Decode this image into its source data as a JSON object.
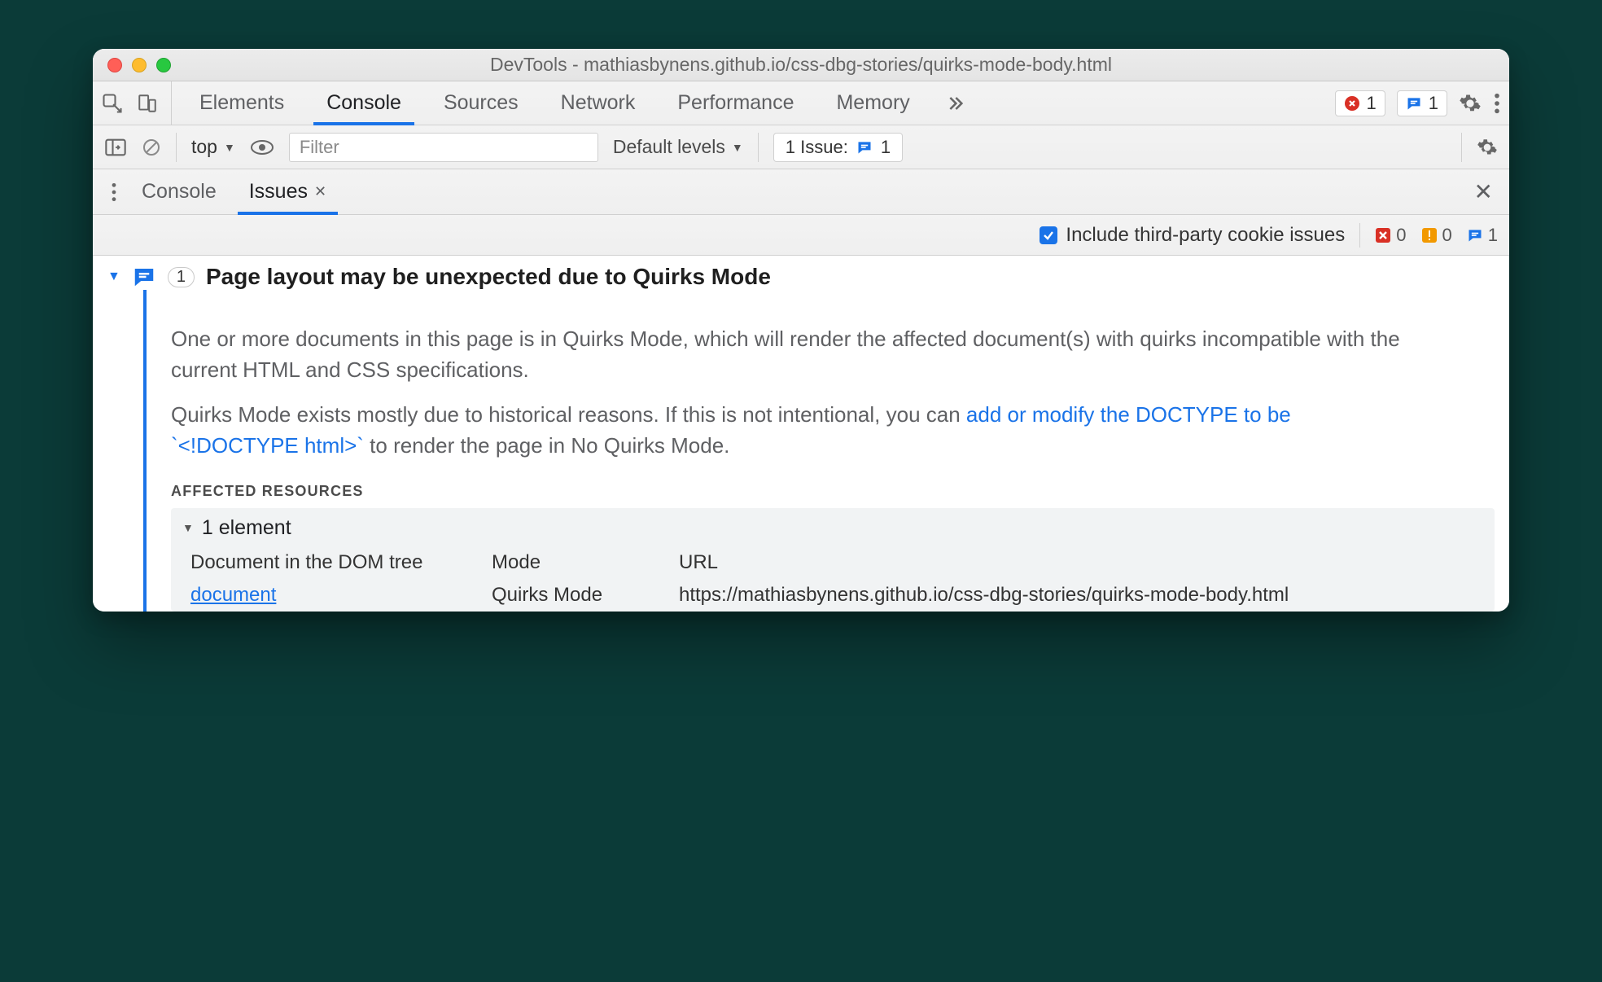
{
  "titlebar": {
    "title": "DevTools - mathiasbynens.github.io/css-dbg-stories/quirks-mode-body.html"
  },
  "tabs": [
    "Elements",
    "Console",
    "Sources",
    "Network",
    "Performance",
    "Memory"
  ],
  "activeTab": "Console",
  "badges": {
    "errors": "1",
    "issues": "1"
  },
  "subbar": {
    "context": "top",
    "filter_placeholder": "Filter",
    "levels": "Default levels",
    "issue_label": "1 Issue:",
    "issue_count": "1"
  },
  "drawer": {
    "tab1": "Console",
    "tab2": "Issues"
  },
  "issues_opts": {
    "cookie_label": "Include third-party cookie issues",
    "red": "0",
    "orange": "0",
    "blue": "1"
  },
  "issue": {
    "badge": "1",
    "title": "Page layout may be unexpected due to Quirks Mode",
    "p1": "One or more documents in this page is in Quirks Mode, which will render the affected document(s) with quirks incompatible with the current HTML and CSS specifications.",
    "p2a": "Quirks Mode exists mostly due to historical reasons. If this is not intentional, you can ",
    "p2link": "add or modify the DOCTYPE to be `<!DOCTYPE html>`",
    "p2b": " to render the page in No Quirks Mode.",
    "affected_label": "AFFECTED RESOURCES",
    "elements_label": "1 element",
    "cols": {
      "c1": "Document in the DOM tree",
      "c2": "Mode",
      "c3": "URL"
    },
    "row": {
      "doc": "document",
      "mode": "Quirks Mode",
      "url": "https://mathiasbynens.github.io/css-dbg-stories/quirks-mode-body.html"
    }
  }
}
